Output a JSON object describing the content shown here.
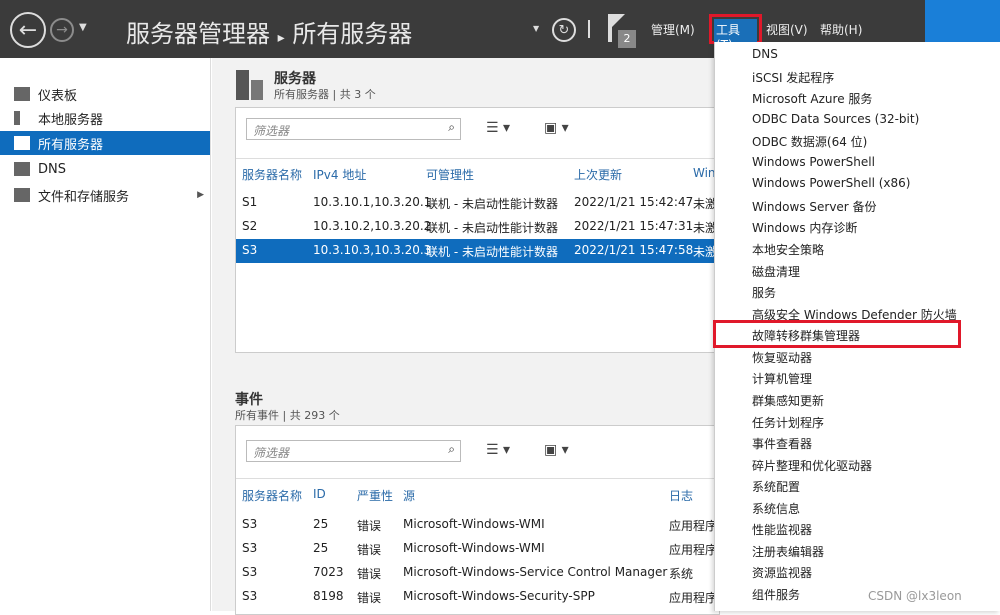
{
  "header": {
    "title": "服务器管理器",
    "separator": "▸",
    "page": "所有服务器",
    "notification_count": "2",
    "menus": {
      "manage": "管理(M)",
      "tools": "工具(T)",
      "view": "视图(V)",
      "help": "帮助(H)"
    }
  },
  "sidebar": {
    "items": [
      {
        "label": "仪表板",
        "icon": "dashboard-icon"
      },
      {
        "label": "本地服务器",
        "icon": "server-icon"
      },
      {
        "label": "所有服务器",
        "icon": "servers-icon"
      },
      {
        "label": "DNS",
        "icon": "dns-icon"
      },
      {
        "label": "文件和存储服务",
        "icon": "storage-icon"
      }
    ]
  },
  "servers": {
    "title": "服务器",
    "subtitle": "所有服务器 | 共 3 个",
    "filter_placeholder": "筛选器",
    "columns": [
      "服务器名称",
      "IPv4 地址",
      "可管理性",
      "上次更新",
      "Win"
    ],
    "rows": [
      [
        "S1",
        "10.3.10.1,10.3.20.1",
        "联机 - 未启动性能计数器",
        "2022/1/21 15:42:47",
        "未激"
      ],
      [
        "S2",
        "10.3.10.2,10.3.20.2",
        "联机 - 未启动性能计数器",
        "2022/1/21 15:47:31",
        "未激"
      ],
      [
        "S3",
        "10.3.10.3,10.3.20.3",
        "联机 - 未启动性能计数器",
        "2022/1/21 15:47:58",
        "未激"
      ]
    ]
  },
  "events": {
    "title": "事件",
    "subtitle": "所有事件 | 共 293 个",
    "filter_placeholder": "筛选器",
    "columns": [
      "服务器名称",
      "ID",
      "严重性",
      "源",
      "日志"
    ],
    "rows": [
      [
        "S3",
        "25",
        "错误",
        "Microsoft-Windows-WMI",
        "应用程序"
      ],
      [
        "S3",
        "25",
        "错误",
        "Microsoft-Windows-WMI",
        "应用程序"
      ],
      [
        "S3",
        "7023",
        "错误",
        "Microsoft-Windows-Service Control Manager",
        "系统"
      ],
      [
        "S3",
        "8198",
        "错误",
        "Microsoft-Windows-Security-SPP",
        "应用程序"
      ]
    ]
  },
  "tools_menu": [
    "DNS",
    "iSCSI 发起程序",
    "Microsoft Azure 服务",
    "ODBC Data Sources (32-bit)",
    "ODBC 数据源(64 位)",
    "Windows PowerShell",
    "Windows PowerShell (x86)",
    "Windows Server 备份",
    "Windows 内存诊断",
    "本地安全策略",
    "磁盘清理",
    "服务",
    "高级安全 Windows Defender 防火墙",
    "故障转移群集管理器",
    "恢复驱动器",
    "计算机管理",
    "群集感知更新",
    "任务计划程序",
    "事件查看器",
    "碎片整理和优化驱动器",
    "系统配置",
    "系统信息",
    "性能监视器",
    "注册表编辑器",
    "资源监视器",
    "组件服务"
  ],
  "watermark": "CSDN @lx3leon"
}
